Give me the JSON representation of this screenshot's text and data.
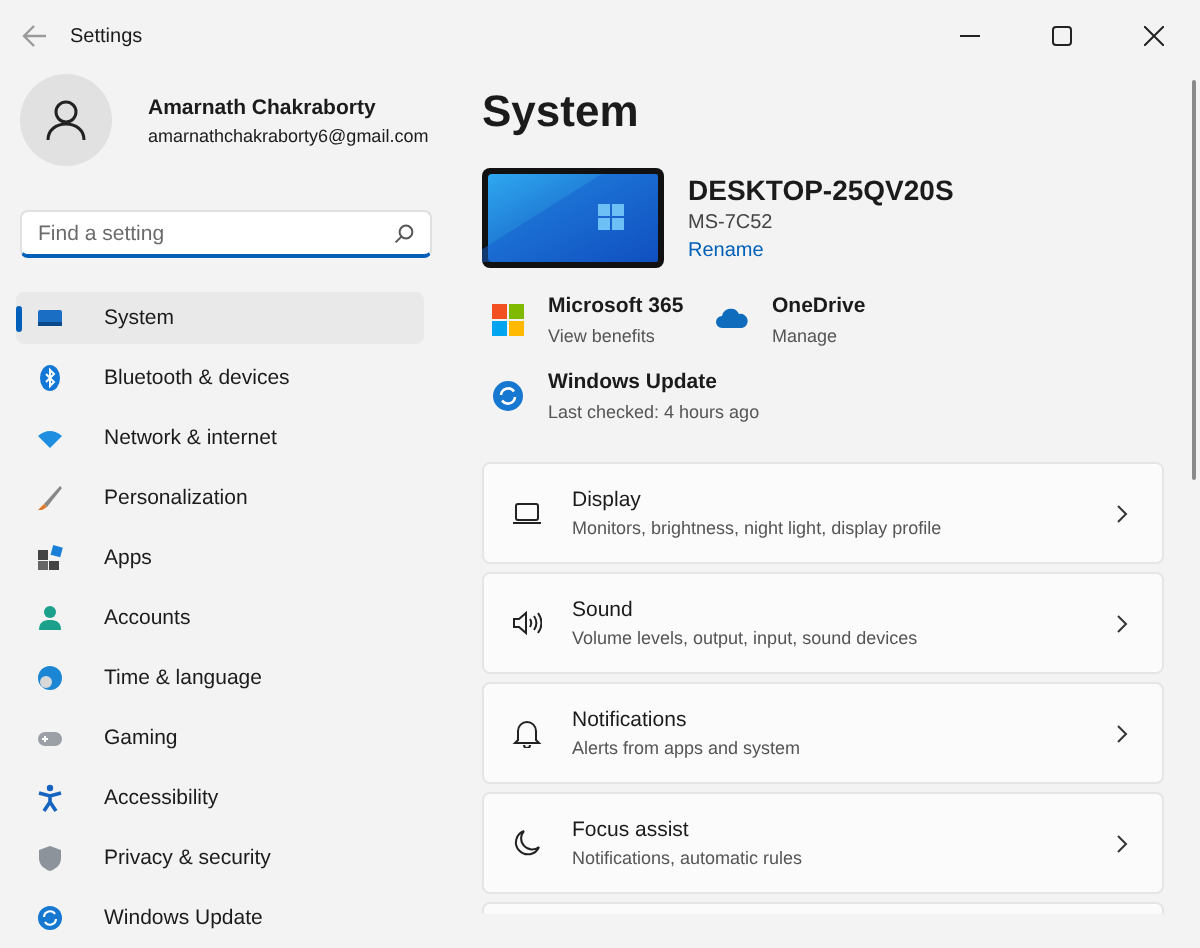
{
  "window": {
    "title": "Settings"
  },
  "user": {
    "name": "Amarnath Chakraborty",
    "email": "amarnathchakraborty6@gmail.com"
  },
  "search": {
    "placeholder": "Find a setting"
  },
  "sidebar": {
    "items": [
      {
        "label": "System",
        "selected": true
      },
      {
        "label": "Bluetooth & devices",
        "selected": false
      },
      {
        "label": "Network & internet",
        "selected": false
      },
      {
        "label": "Personalization",
        "selected": false
      },
      {
        "label": "Apps",
        "selected": false
      },
      {
        "label": "Accounts",
        "selected": false
      },
      {
        "label": "Time & language",
        "selected": false
      },
      {
        "label": "Gaming",
        "selected": false
      },
      {
        "label": "Accessibility",
        "selected": false
      },
      {
        "label": "Privacy & security",
        "selected": false
      },
      {
        "label": "Windows Update",
        "selected": false
      }
    ]
  },
  "page": {
    "title": "System",
    "device": {
      "name": "DESKTOP-25QV20S",
      "model": "MS-7C52",
      "link": "Rename"
    },
    "tiles": [
      {
        "title": "Microsoft 365",
        "subtitle": "View benefits"
      },
      {
        "title": "OneDrive",
        "subtitle": "Manage"
      },
      {
        "title": "Windows Update",
        "subtitle": "Last checked: 4 hours ago"
      }
    ],
    "cards": [
      {
        "title": "Display",
        "subtitle": "Monitors, brightness, night light, display profile"
      },
      {
        "title": "Sound",
        "subtitle": "Volume levels, output, input, sound devices"
      },
      {
        "title": "Notifications",
        "subtitle": "Alerts from apps and system"
      },
      {
        "title": "Focus assist",
        "subtitle": "Notifications, automatic rules"
      }
    ]
  }
}
